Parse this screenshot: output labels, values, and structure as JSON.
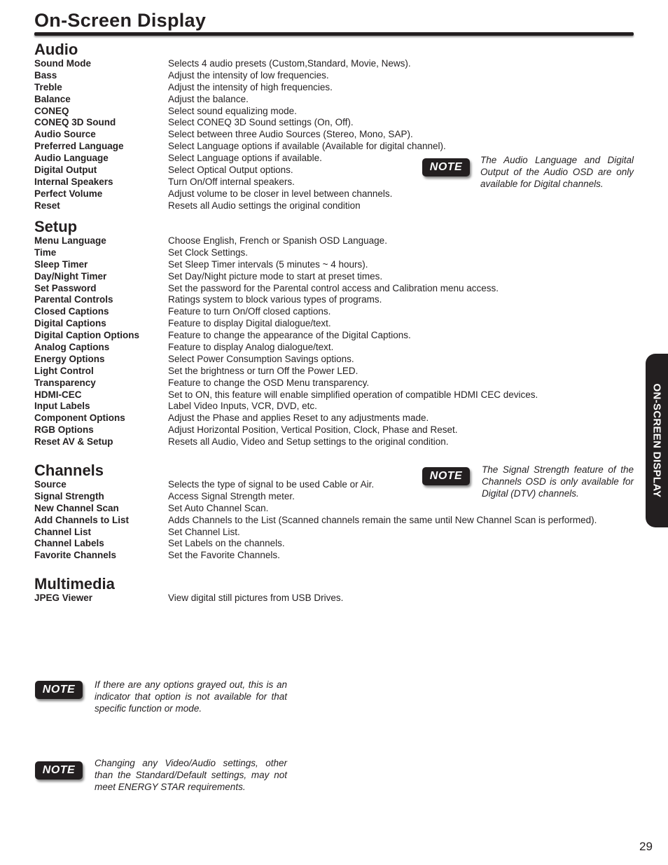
{
  "page": {
    "title": "On-Screen Display",
    "side_tab": "ON-SCREEN DISPLAY",
    "page_number": "29"
  },
  "sections": {
    "audio": {
      "heading": "Audio",
      "items": [
        {
          "term": "Sound Mode",
          "desc": "Selects 4 audio presets (Custom,Standard, Movie, News)."
        },
        {
          "term": "Bass",
          "desc": "Adjust the intensity of low frequencies."
        },
        {
          "term": "Treble",
          "desc": "Adjust the intensity of high frequencies."
        },
        {
          "term": "Balance",
          "desc": "Adjust the balance."
        },
        {
          "term": "CONEQ",
          "desc": "Select sound equalizing mode."
        },
        {
          "term": "CONEQ 3D Sound",
          "desc": "Select CONEQ 3D Sound settings (On, Off)."
        },
        {
          "term": "Audio Source",
          "desc": "Select between three Audio Sources (Stereo, Mono, SAP)."
        },
        {
          "term": "Preferred Language",
          "desc": "Select Language options if available (Available for digital channel)."
        },
        {
          "term": "Audio Language",
          "desc": "Select Language options if available."
        },
        {
          "term": "Digital Output",
          "desc": "Select Optical Output options."
        },
        {
          "term": "Internal Speakers",
          "desc": "Turn On/Off internal speakers."
        },
        {
          "term": "Perfect Volume",
          "desc": "Adjust volume to be closer in level between channels."
        },
        {
          "term": "Reset",
          "desc": "Resets all Audio settings the original condition"
        }
      ],
      "note": {
        "badge": "NOTE",
        "text": "The Audio Language and Digital Output of the Audio OSD are only available for Digital channels."
      }
    },
    "setup": {
      "heading": "Setup",
      "items": [
        {
          "term": "Menu Language",
          "desc": "Choose English, French or Spanish OSD Language."
        },
        {
          "term": "Time",
          "desc": "Set Clock Settings."
        },
        {
          "term": "Sleep Timer",
          "desc": "Set Sleep Timer intervals (5 minutes ~ 4 hours)."
        },
        {
          "term": "Day/Night Timer",
          "desc": "Set Day/Night picture mode to start at preset times."
        },
        {
          "term": "Set Password",
          "desc": "Set the password for the Parental control access and Calibration menu access."
        },
        {
          "term": "Parental Controls",
          "desc": "Ratings system to block various types of programs."
        },
        {
          "term": "Closed Captions",
          "desc": "Feature to turn On/Off closed captions."
        },
        {
          "term": "Digital Captions",
          "desc": "Feature to display Digital dialogue/text."
        },
        {
          "term": "Digital Caption Options",
          "desc": "Feature to change the appearance of the Digital Captions."
        },
        {
          "term": "Analog Captions",
          "desc": "Feature to display Analog dialogue/text."
        },
        {
          "term": "Energy Options",
          "desc": "Select Power Consumption Savings options."
        },
        {
          "term": "Light Control",
          "desc": "Set the brightness or turn Off the Power LED."
        },
        {
          "term": "Transparency",
          "desc": "Feature to change the OSD Menu transparency."
        },
        {
          "term": "HDMI-CEC",
          "desc": "Set to ON, this feature will enable simplified operation of compatible HDMI CEC devices."
        },
        {
          "term": "Input Labels",
          "desc": "Label Video Inputs, VCR, DVD, etc."
        },
        {
          "term": "Component Options",
          "desc": "Adjust the Phase and applies Reset to any adjustments made."
        },
        {
          "term": "RGB Options",
          "desc": "Adjust Horizontal Position, Vertical Position, Clock, Phase and Reset."
        },
        {
          "term": "Reset AV & Setup",
          "desc": "Resets all Audio, Video and Setup settings to the original condition."
        }
      ]
    },
    "channels": {
      "heading": "Channels",
      "items": [
        {
          "term": "Source",
          "desc": "Selects the type of signal to be used Cable or Air."
        },
        {
          "term": "Signal Strength",
          "desc": "Access Signal Strength meter."
        },
        {
          "term": "New Channel Scan",
          "desc": "Set Auto Channel Scan."
        },
        {
          "term": "Add Channels to List",
          "desc": "Adds Channels to the List (Scanned channels remain the same until New Channel Scan is performed)."
        },
        {
          "term": "Channel List",
          "desc": "Set Channel List."
        },
        {
          "term": "Channel Labels",
          "desc": "Set Labels on the channels."
        },
        {
          "term": "Favorite Channels",
          "desc": "Set the Favorite Channels."
        }
      ],
      "note": {
        "badge": "NOTE",
        "text": "The Signal Strength feature of the Channels OSD is only available for Digital (DTV) channels."
      }
    },
    "multimedia": {
      "heading": "Multimedia",
      "items": [
        {
          "term": "JPEG Viewer",
          "desc": "View digital still pictures from USB Drives."
        }
      ]
    }
  },
  "bottom_notes": [
    {
      "badge": "NOTE",
      "text": "If there are any options grayed out, this is an indicator that option is not available for that specific function or mode."
    },
    {
      "badge": "NOTE",
      "text": "Changing any Video/Audio settings, other than the Standard/Default settings, may not meet ENERGY STAR requirements."
    }
  ]
}
